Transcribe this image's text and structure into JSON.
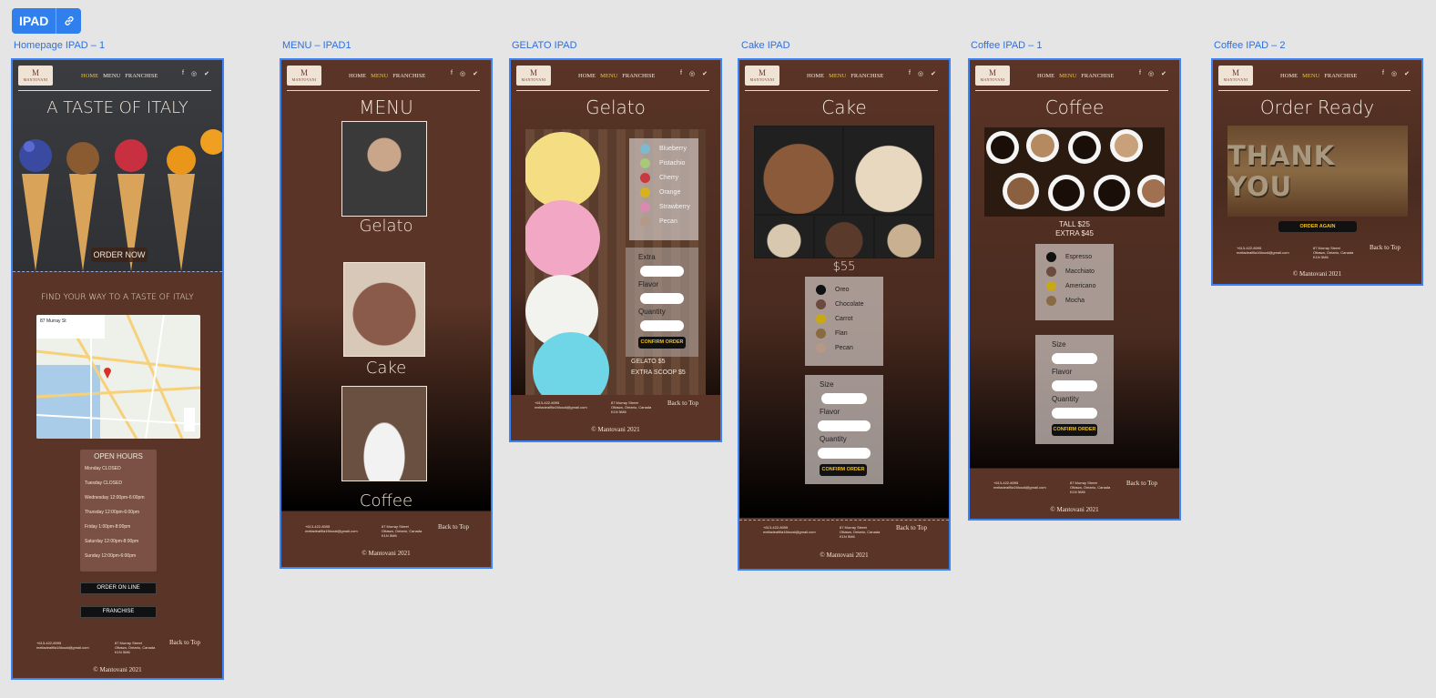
{
  "toolbar": {
    "label": "IPAD",
    "link_icon": "link-icon"
  },
  "artboards": [
    {
      "label": "Homepage IPAD – 1"
    },
    {
      "label": "MENU – IPAD1"
    },
    {
      "label": "GELATO IPAD"
    },
    {
      "label": "Cake IPAD"
    },
    {
      "label": "Coffee IPAD – 1"
    },
    {
      "label": "Coffee IPAD – 2"
    }
  ],
  "nav": {
    "logo_text": "MANTOVANI",
    "logo_mark": "M",
    "links": [
      "HOME",
      "MENU",
      "FRANCHISE"
    ],
    "social_icons": [
      "facebook-icon",
      "instagram-icon",
      "twitter-icon"
    ]
  },
  "home": {
    "hero_title": "A TASTE OF ITALY",
    "order_now": "ORDER NOW",
    "find_way": "FIND YOUR WAY TO A TASTE OF ITALY",
    "map_address": "87 Murray St",
    "hours_title": "OPEN HOURS",
    "hours": [
      "Monday CLOSED",
      "Tuesday CLOSED",
      "Wednesday 12:00pm-6:00pm",
      "Thursday 12:00pm-6:00pm",
      "Friday 1:00pm-8:00pm",
      "Saturday 12:00pm-8:00pm",
      "Sunday 12:00pm-6:00pm"
    ],
    "order_online": "ORDER ON LINE",
    "franchise": "FRANCHISE"
  },
  "menu": {
    "title": "MENU",
    "items": [
      "Gelato",
      "Cake",
      "Coffee"
    ]
  },
  "gelato": {
    "title": "Gelato",
    "flavors": [
      {
        "name": "Blueberry",
        "color": "#7fb9d0"
      },
      {
        "name": "Pistachio",
        "color": "#a9c97a"
      },
      {
        "name": "Cherry",
        "color": "#c9393f"
      },
      {
        "name": "Orange",
        "color": "#d7b21e"
      },
      {
        "name": "Strawberry",
        "color": "#d88ab0"
      },
      {
        "name": "Pecan",
        "color": "#b49a86"
      }
    ],
    "fields": [
      "Extra",
      "Flavor",
      "Quantity"
    ],
    "confirm": "CONFIRM ORDER",
    "price_1": "GELATO $5",
    "price_2": "EXTRA SCOOP $5"
  },
  "cake": {
    "title": "Cake",
    "price": "$55",
    "flavors": [
      {
        "name": "Oreo",
        "color": "#111111"
      },
      {
        "name": "Chocolate",
        "color": "#6b4a3f"
      },
      {
        "name": "Carrot",
        "color": "#c9a815"
      },
      {
        "name": "Flan",
        "color": "#8a6a40"
      },
      {
        "name": "Pecan",
        "color": "#b49a86"
      }
    ],
    "fields": [
      "Size",
      "Flavor",
      "Quantity"
    ],
    "confirm": "CONFIRM ORDER"
  },
  "coffee": {
    "title": "Coffee",
    "price_1": "TALL $25",
    "price_2": "EXTRA $45",
    "flavors": [
      {
        "name": "Espresso",
        "color": "#111111"
      },
      {
        "name": "Macchiato",
        "color": "#6b4a3f"
      },
      {
        "name": "Americano",
        "color": "#c9a815"
      },
      {
        "name": "Mocha",
        "color": "#8a6a40"
      }
    ],
    "fields": [
      "Size",
      "Flavor",
      "Quantity"
    ],
    "confirm": "CONFIRM ORDER"
  },
  "order": {
    "title": "Order Ready",
    "thank_you": "THANK YOU",
    "order_again": "ORDER AGAIN"
  },
  "footer": {
    "back_to_top": "Back to Top",
    "copyright": "© Mantovani 2021",
    "contact": "+613-422-8095\nmeliadealfila16tooal@gmail.com",
    "address": "87 Murray Street\nOttawa, Ontario, Canada\nK1N 5M6"
  },
  "colors": {
    "brown": "#5a3426",
    "dark": "#1a0f0b",
    "accent_yellow": "#e6c23a",
    "artboard_border": "#3b82f6"
  }
}
